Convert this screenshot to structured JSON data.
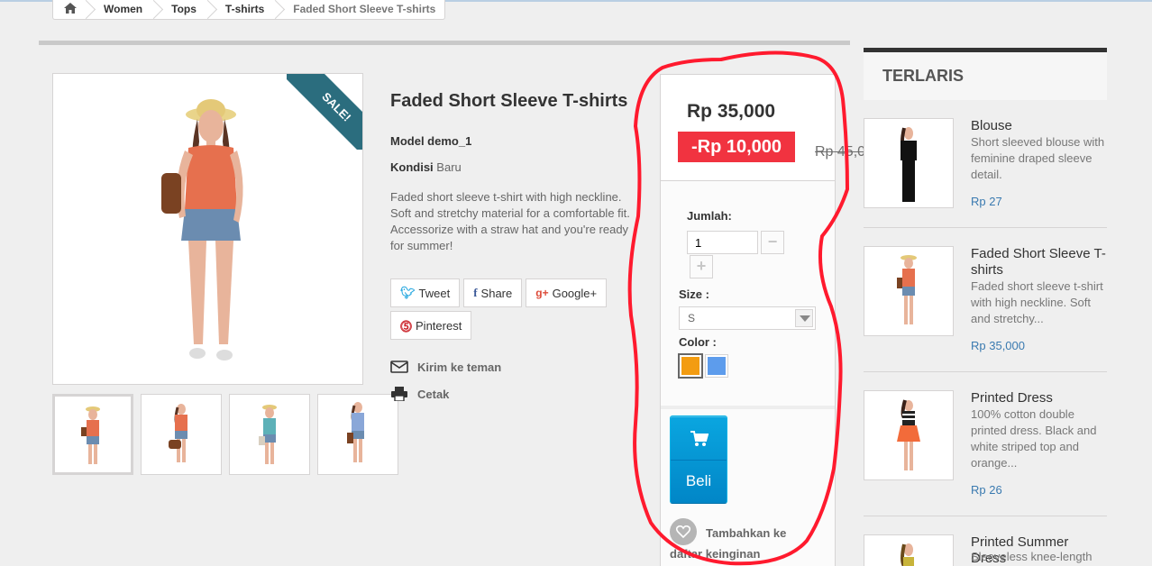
{
  "breadcrumb": {
    "home_icon": "home-icon",
    "items": [
      "Women",
      "Tops",
      "T-shirts"
    ],
    "current": "Faded Short Sleeve T-shirts"
  },
  "product": {
    "sale_badge": "SALE!",
    "title": "Faded Short Sleeve T-shirts",
    "model": "Model demo_1",
    "condition_label": "Kondisi",
    "condition_value": "Baru",
    "description": "Faded short sleeve t-shirt with high neckline. Soft and stretchy material for a comfortable fit. Accessorize with a straw hat and you're ready for summer!",
    "social": {
      "tweet": "Tweet",
      "share": "Share",
      "google": "Google+",
      "pinterest": "Pinterest"
    },
    "send_friend": "Kirim ke teman",
    "print": "Cetak"
  },
  "pricebox": {
    "price": "Rp 35,000",
    "discount": "-Rp 10,000",
    "old_price": "Rp 45,0",
    "qty_label": "Jumlah:",
    "qty_value": "1",
    "minus": "−",
    "plus": "+",
    "size_label": "Size :",
    "size_value": "S",
    "color_label": "Color :",
    "colors": [
      "#f39c11",
      "#5d9cec"
    ],
    "buy_label": "Beli",
    "wishlist_line1": "Tambahkan ke",
    "wishlist_line2": "daftar keinginan"
  },
  "sidebar": {
    "title": "TERLARIS",
    "items": [
      {
        "name": "Blouse",
        "desc": "Short sleeved blouse with feminine draped sleeve detail.",
        "price": "Rp 27"
      },
      {
        "name": "Faded Short Sleeve T-shirts",
        "desc": "Faded short sleeve t-shirt with high neckline. Soft and stretchy...",
        "price": "Rp 35,000"
      },
      {
        "name": "Printed Dress",
        "desc": "100% cotton double printed dress. Black and white striped top and orange...",
        "price": "Rp 26"
      },
      {
        "name": "Printed Summer Dress",
        "desc": "Sleeveless knee-length",
        "price": ""
      }
    ]
  },
  "colors": {
    "accent_blue": "#0aa6e0",
    "discount_red": "#f13340",
    "annotation_red": "#ff1a2e",
    "ribbon": "#2b6d7e"
  }
}
